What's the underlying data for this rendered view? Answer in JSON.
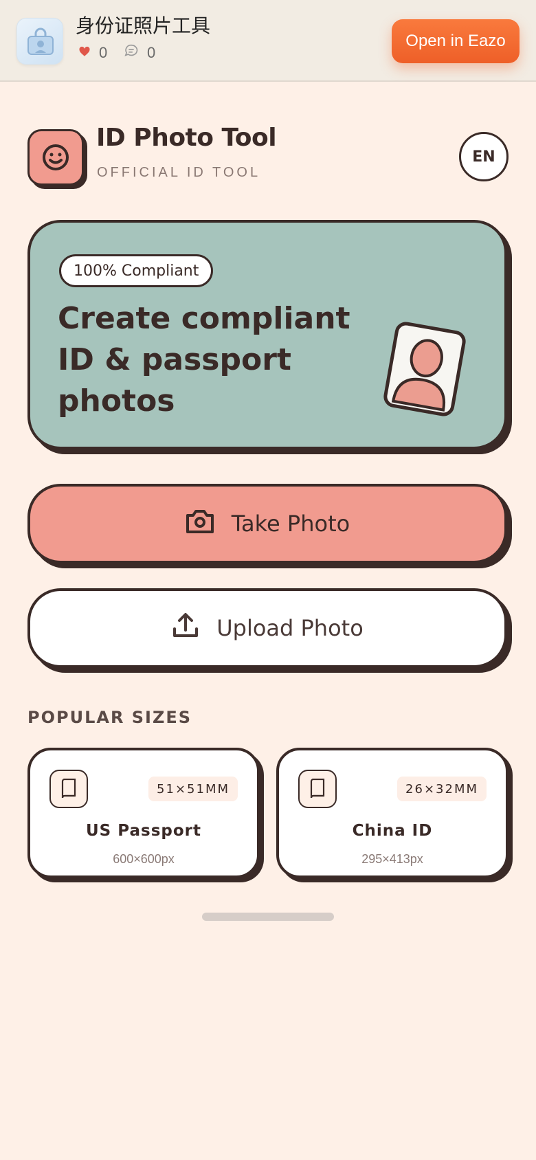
{
  "banner": {
    "app_title": "身份证照片工具",
    "likes": "0",
    "comments": "0",
    "open_button": "Open in Eazo"
  },
  "header": {
    "title": "ID Photo Tool",
    "subtitle": "OFFICIAL ID TOOL",
    "language": "EN"
  },
  "hero": {
    "badge": "100% Compliant",
    "headline": "Create compliant ID & passport photos"
  },
  "actions": {
    "take_photo": "Take Photo",
    "upload_photo": "Upload Photo"
  },
  "popular": {
    "title": "POPULAR SIZES",
    "sizes": [
      {
        "name": "US Passport",
        "dimensions": "51×51MM",
        "pixels": "600×600px"
      },
      {
        "name": "China ID",
        "dimensions": "26×32MM",
        "pixels": "295×413px"
      }
    ]
  },
  "colors": {
    "background": "#fef0e7",
    "accent_pink": "#f19b8f",
    "hero_green": "#a6c4bc",
    "ink": "#3a2a27",
    "cta_orange": "#ee5f28"
  }
}
